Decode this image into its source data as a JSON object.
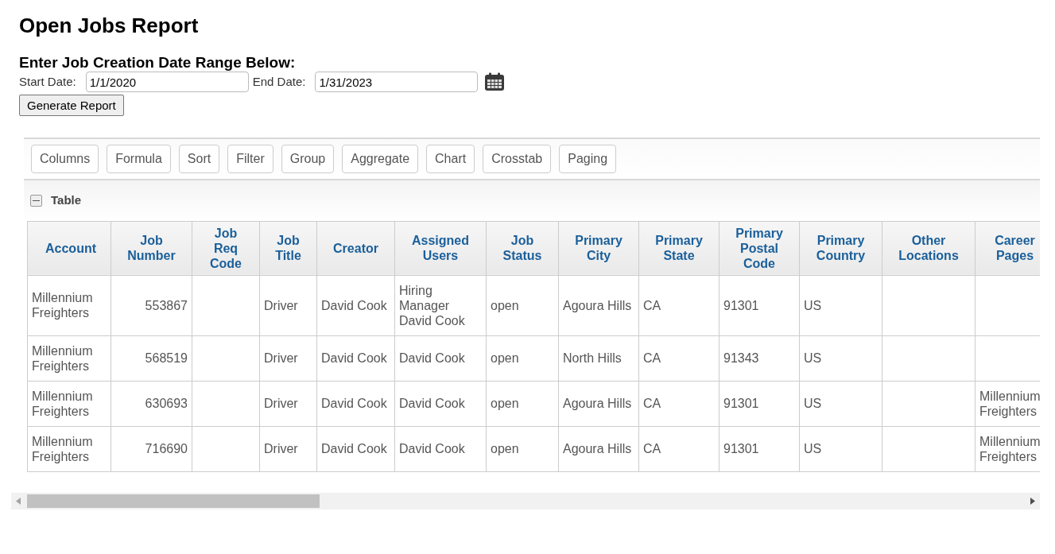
{
  "title": "Open Jobs Report",
  "date_form": {
    "heading": "Enter Job Creation Date Range Below:",
    "fields": [
      {
        "label": "Start Date:",
        "value": "1/1/2020"
      },
      {
        "label": "End Date:",
        "value": "1/31/2023"
      }
    ],
    "button": "Generate Report"
  },
  "toolbar": [
    "Columns",
    "Formula",
    "Sort",
    "Filter",
    "Group",
    "Aggregate",
    "Chart",
    "Crosstab",
    "Paging"
  ],
  "section": {
    "label": "Table",
    "expanded": true
  },
  "table": {
    "columns": [
      {
        "label": "Account",
        "kind": "text"
      },
      {
        "label": "Job Number",
        "kind": "number"
      },
      {
        "label": "Job Req Code",
        "kind": "text"
      },
      {
        "label": "Job Title",
        "kind": "text"
      },
      {
        "label": "Creator",
        "kind": "text"
      },
      {
        "label": "Assigned Users",
        "kind": "text"
      },
      {
        "label": "Job Status",
        "kind": "text"
      },
      {
        "label": "Primary City",
        "kind": "text"
      },
      {
        "label": "Primary State",
        "kind": "text"
      },
      {
        "label": "Primary Postal Code",
        "kind": "text"
      },
      {
        "label": "Primary Country",
        "kind": "text"
      },
      {
        "label": "Other Locations",
        "kind": "text"
      },
      {
        "label": "Career Pages",
        "kind": "text"
      }
    ],
    "rows": [
      [
        "Millennium Freighters",
        "553867",
        "",
        "Driver",
        "David Cook",
        "Hiring Manager David Cook",
        "open",
        "Agoura Hills",
        "CA",
        "91301",
        "US",
        "",
        ""
      ],
      [
        "Millennium Freighters",
        "568519",
        "",
        "Driver",
        "David Cook",
        "David Cook",
        "open",
        "North Hills",
        "CA",
        "91343",
        "US",
        "",
        ""
      ],
      [
        "Millennium Freighters",
        "630693",
        "",
        "Driver",
        "David Cook",
        "David Cook",
        "open",
        "Agoura Hills",
        "CA",
        "91301",
        "US",
        "",
        "Millennium Freighters"
      ],
      [
        "Millennium Freighters",
        "716690",
        "",
        "Driver",
        "David Cook",
        "David Cook",
        "open",
        "Agoura Hills",
        "CA",
        "91301",
        "US",
        "",
        "Millennium Freighters"
      ]
    ]
  }
}
